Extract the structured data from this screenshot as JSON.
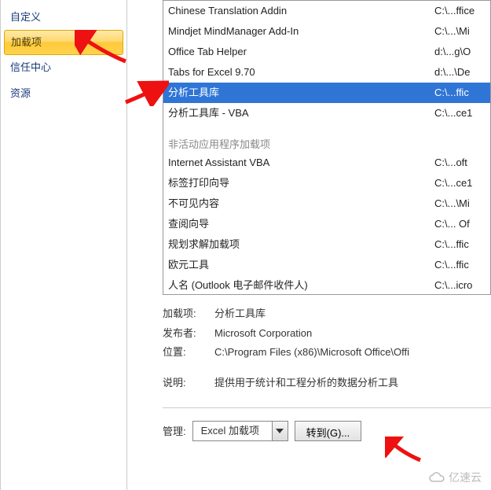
{
  "sidebar": {
    "items": [
      {
        "label": "自定义"
      },
      {
        "label": "加载项"
      },
      {
        "label": "信任中心"
      },
      {
        "label": "资源"
      }
    ]
  },
  "addins": {
    "active": [
      {
        "name": "Chinese Translation Addin",
        "path": "C:\\...ffice"
      },
      {
        "name": "Mindjet MindManager Add-In",
        "path": "C:\\...\\Mi"
      },
      {
        "name": "Office Tab Helper",
        "path": "d:\\...g\\O"
      },
      {
        "name": "Tabs for Excel 9.70",
        "path": "d:\\...\\De"
      },
      {
        "name": "分析工具库",
        "path": "C:\\...ffic"
      },
      {
        "name": "分析工具库 - VBA",
        "path": "C:\\...ce1"
      }
    ],
    "inactive_header": "非活动应用程序加载项",
    "inactive": [
      {
        "name": "Internet Assistant VBA",
        "path": "C:\\...oft"
      },
      {
        "name": "标签打印向导",
        "path": "C:\\...ce1"
      },
      {
        "name": "不可见内容",
        "path": "C:\\...\\Mi"
      },
      {
        "name": "查阅向导",
        "path": "C:\\... Of"
      },
      {
        "name": "规划求解加载项",
        "path": "C:\\...ffic"
      },
      {
        "name": "欧元工具",
        "path": "C:\\...ffic"
      },
      {
        "name": "人名 (Outlook 电子邮件收件人)",
        "path": "C:\\...icro"
      }
    ]
  },
  "details": {
    "addin_label": "加载项:",
    "addin_value": "分析工具库",
    "publisher_label": "发布者:",
    "publisher_value": "Microsoft Corporation",
    "location_label": "位置:",
    "location_value": "C:\\Program Files (x86)\\Microsoft Office\\Offi",
    "description_label": "说明:",
    "description_value": "提供用于统计和工程分析的数据分析工具"
  },
  "bottom": {
    "manage_label": "管理:",
    "dropdown_value": "Excel 加载项",
    "go_button": "转到(G)..."
  },
  "watermark": "亿速云"
}
